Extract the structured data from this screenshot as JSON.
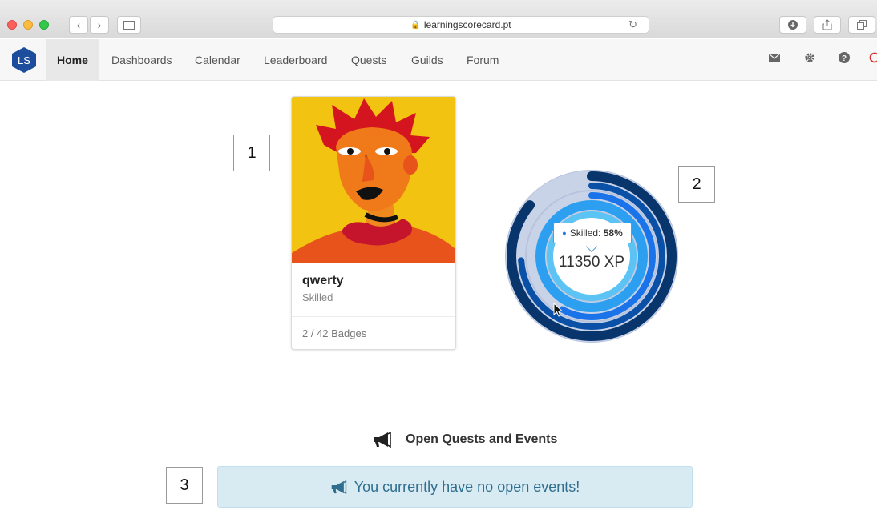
{
  "browser": {
    "url": "learningscorecard.pt"
  },
  "nav": {
    "logo_text": "LS",
    "items": [
      {
        "label": "Home",
        "active": true
      },
      {
        "label": "Dashboards"
      },
      {
        "label": "Calendar"
      },
      {
        "label": "Leaderboard"
      },
      {
        "label": "Quests"
      },
      {
        "label": "Guilds"
      },
      {
        "label": "Forum"
      }
    ],
    "icons": [
      "mail-icon",
      "gear-icon",
      "help-icon"
    ]
  },
  "profile": {
    "name": "qwerty",
    "level": "Skilled",
    "badges": "2 / 42 Badges"
  },
  "xp_chart": {
    "xp_label": "11350 XP",
    "tooltip_series": "Skilled:",
    "tooltip_value": "58%",
    "colors": {
      "track": "#b7c3dc",
      "rings": [
        "#08356b",
        "#0a50a7",
        "#1a73e8",
        "#2d9ff0"
      ]
    },
    "progress": [
      0.86,
      0.74,
      0.58,
      1.0
    ]
  },
  "callouts": [
    "1",
    "2",
    "3"
  ],
  "section": {
    "title": "Open Quests and Events"
  },
  "alert": {
    "text": "You currently have no open events!"
  }
}
